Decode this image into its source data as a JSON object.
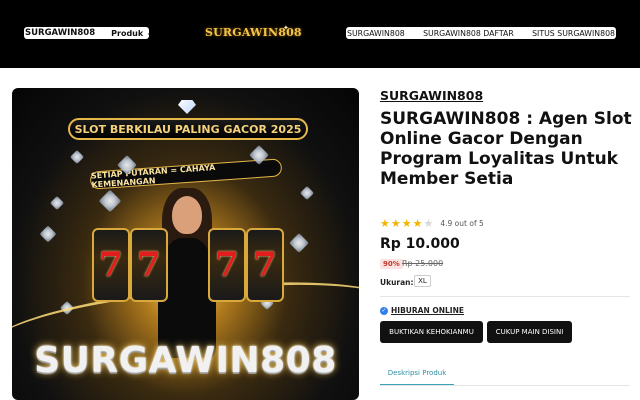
{
  "header": {
    "brand": "SURGAWIN808",
    "menu_label": "Produk",
    "logo_text": "SURGAWIN808",
    "nav_links": [
      "SURGAWIN808",
      "SURGAWIN808 DAFTAR",
      "SITUS SURGAWIN808"
    ]
  },
  "banner": {
    "top_ribbon": "SLOT BERKILAU PALING GACOR 2025",
    "second_ribbon": "SETIAP PUTARAN = CAHAYA KEMENANGAN",
    "reel_symbol": "7",
    "big_title": "SURGAWIN808"
  },
  "product": {
    "subtitle": "SURGAWIN808",
    "title": "SURGAWIN808 : Agen Slot Online Gacor Dengan Program Loyalitas Untuk Member Setia",
    "rating_value": 4.9,
    "rating_text": "4.9 out of 5",
    "price": "Rp 10.000",
    "discount": "90%",
    "old_price": "Rp 25.000",
    "size_label": "Ukuran:",
    "size_option": "XL",
    "online_label": "HIBURAN ONLINE",
    "buttons": [
      "BUKTIKAN KEHOKIANMU",
      "CUKUP MAIN DISINI"
    ],
    "tab_label": "Deskripsi Produk"
  },
  "colors": {
    "header_bg": "#000000",
    "star": "#f5b301",
    "discount_bg": "#fde2e2",
    "discount_text": "#c0392b",
    "tab_accent": "#38a3b8"
  }
}
